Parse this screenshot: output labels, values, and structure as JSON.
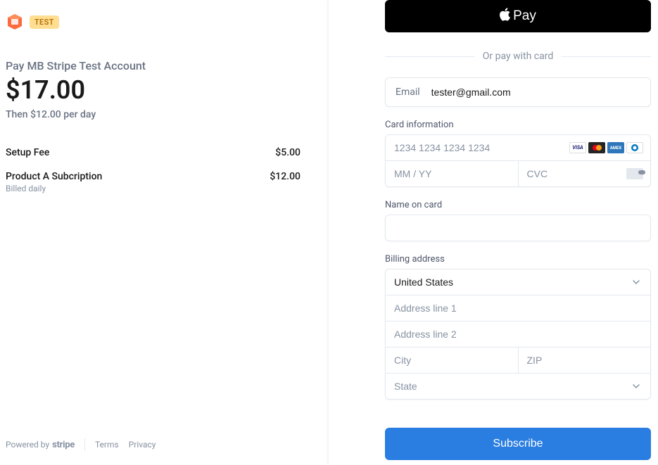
{
  "header": {
    "test_badge": "TEST"
  },
  "summary": {
    "pay_title": "Pay MB Stripe Test Account",
    "amount": "$17.00",
    "recurring": "Then $12.00 per day",
    "items": [
      {
        "label": "Setup Fee",
        "price": "$5.00",
        "sub": ""
      },
      {
        "label": "Product A Subcription",
        "price": "$12.00",
        "sub": "Billed daily"
      }
    ]
  },
  "footer": {
    "powered_by": "Powered by",
    "stripe": "stripe",
    "terms": "Terms",
    "privacy": "Privacy"
  },
  "payment": {
    "apple_pay_label": "Pay",
    "divider_text": "Or pay with card",
    "email": {
      "label": "Email",
      "value": "tester@gmail.com"
    },
    "card": {
      "section_label": "Card information",
      "number_placeholder": "1234 1234 1234 1234",
      "expiry_placeholder": "MM / YY",
      "cvc_placeholder": "CVC"
    },
    "name": {
      "label": "Name on card",
      "value": ""
    },
    "billing": {
      "label": "Billing address",
      "country": "United States",
      "address1_placeholder": "Address line 1",
      "address2_placeholder": "Address line 2",
      "city_placeholder": "City",
      "zip_placeholder": "ZIP",
      "state_placeholder": "State"
    },
    "subscribe_label": "Subscribe"
  }
}
